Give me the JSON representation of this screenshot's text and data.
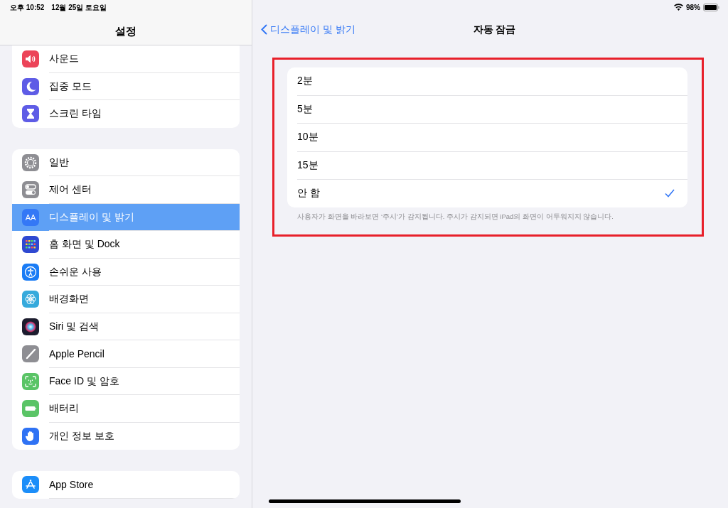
{
  "status_bar": {
    "time": "오후 10:52",
    "date": "12월 25일 토요일",
    "battery": "98%"
  },
  "sidebar": {
    "title": "설정",
    "groups": [
      {
        "items": [
          {
            "label": "사운드",
            "selected": false
          },
          {
            "label": "집중 모드",
            "selected": false
          },
          {
            "label": "스크린 타임",
            "selected": false
          }
        ]
      },
      {
        "items": [
          {
            "label": "일반",
            "selected": false
          },
          {
            "label": "제어 센터",
            "selected": false
          },
          {
            "label": "디스플레이 및 밝기",
            "selected": true,
            "icon_text": "AA"
          },
          {
            "label": "홈 화면 및 Dock",
            "selected": false
          },
          {
            "label": "손쉬운 사용",
            "selected": false
          },
          {
            "label": "배경화면",
            "selected": false
          },
          {
            "label": "Siri 및 검색",
            "selected": false
          },
          {
            "label": "Apple Pencil",
            "selected": false
          },
          {
            "label": "Face ID 및 암호",
            "selected": false
          },
          {
            "label": "배터리",
            "selected": false
          },
          {
            "label": "개인 정보 보호",
            "selected": false
          }
        ]
      },
      {
        "items": [
          {
            "label": "App Store",
            "selected": false
          }
        ]
      }
    ]
  },
  "detail": {
    "back": "디스플레이 및 밝기",
    "title": "자동 잠금",
    "options": [
      {
        "label": "2분",
        "selected": false
      },
      {
        "label": "5분",
        "selected": false
      },
      {
        "label": "10분",
        "selected": false
      },
      {
        "label": "15분",
        "selected": false
      },
      {
        "label": "안 함",
        "selected": true
      }
    ],
    "footnote": "사용자가 화면을 바라보면 ‘주시’가 감지됩니다. 주시가 감지되면 iPad의 화면이 어두워지지 않습니다."
  }
}
